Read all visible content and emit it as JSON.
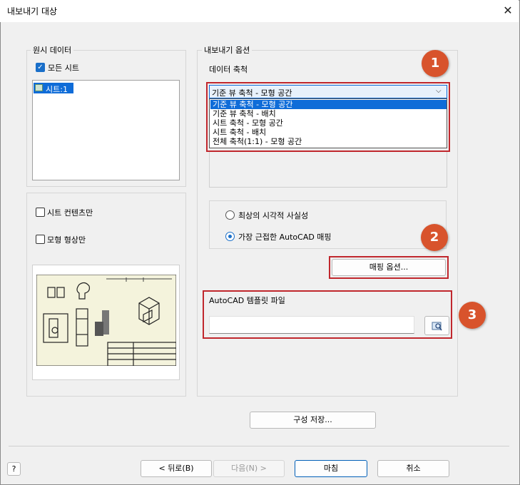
{
  "window": {
    "title": "내보내기 대상",
    "close_glyph": "✕"
  },
  "source": {
    "legend": "원시 데이터",
    "all_sheets_label": "모든 시트",
    "sheets": [
      "시트:1"
    ],
    "sheet_content_only_label": "시트 컨텐츠만",
    "model_geometry_only_label": "모형 형상만"
  },
  "export": {
    "legend": "내보내기 옵션",
    "data_scale_label": "데이터 축척",
    "scale_selected": "기준 뷰 축척 - 모형 공간",
    "scale_options": [
      "기준 뷰 축척 - 모형 공간",
      "기준 뷰 축척 - 배치",
      "시트 축척 - 모형 공간",
      "시트 축척 - 배치",
      "전체 축척(1:1) - 모형 공간"
    ],
    "radio_visual": "최상의 시각적 사실성",
    "radio_mapping": "가장 근접한 AutoCAD 매핑",
    "mapping_options_button": "매핑 옵션...",
    "template_label": "AutoCAD 템플릿 파일",
    "template_value": ""
  },
  "save_config_button": "구성 저장...",
  "footer": {
    "help_glyph": "?",
    "back_button": "< 뒤로(B)",
    "next_button": "다음(N) >",
    "finish_button": "마침",
    "cancel_button": "취소"
  },
  "callouts": [
    "1",
    "2",
    "3"
  ],
  "colors": {
    "accent": "#0f6cd8",
    "callout_border": "#c0272d",
    "callout_badge": "#d8532c"
  }
}
